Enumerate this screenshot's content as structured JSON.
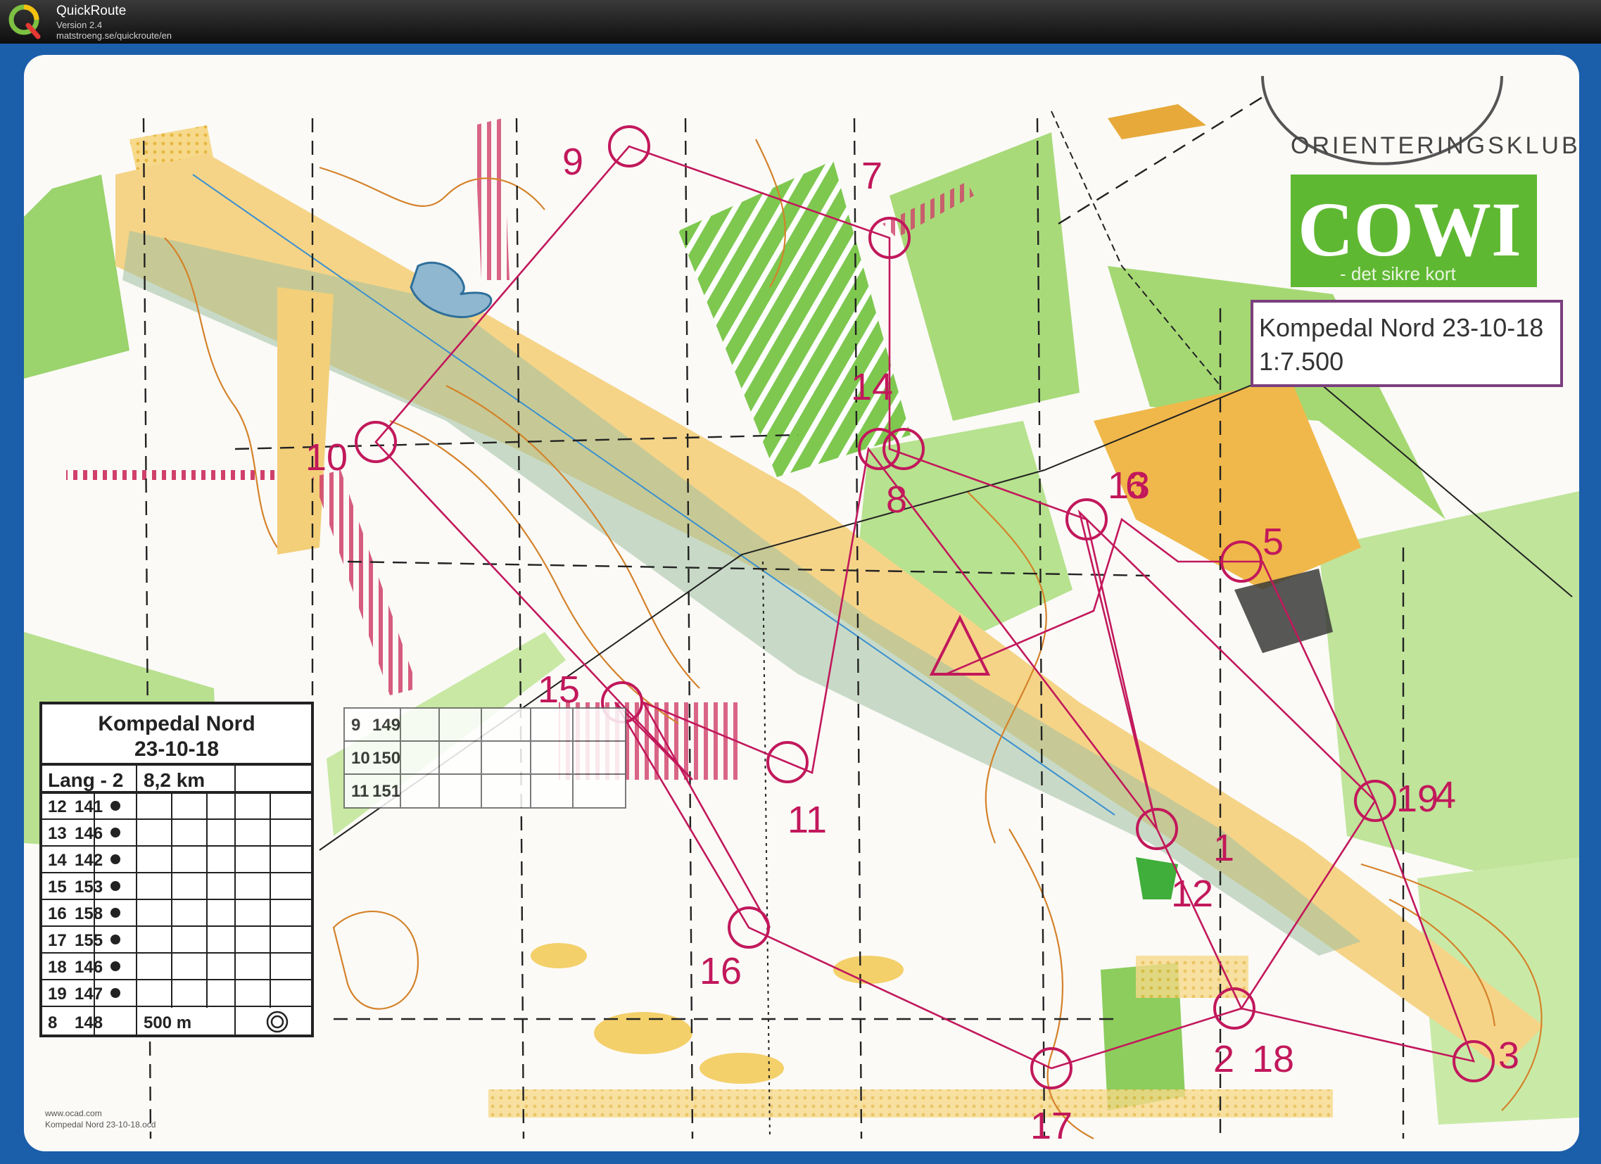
{
  "app": {
    "title": "QuickRoute",
    "version": "Version 2.4",
    "url": "matstroeng.se/quickroute/en"
  },
  "map": {
    "sponsor": "COWI",
    "sponsor_tagline": "- det sikre kort",
    "club_seal": "ORIENTERINGSKLUB",
    "title": "Kompedal Nord 23-10-18",
    "scale": "1:7.500",
    "footnote_1": "www.ocad.com",
    "footnote_2": "Kompedal Nord 23-10-18.ocd"
  },
  "legend": {
    "title": "Kompedal Nord",
    "date": "23-10-18",
    "course": "Lang - 2",
    "distance": "8,2 km",
    "rows": [
      {
        "num": "12",
        "code": "141"
      },
      {
        "num": "13",
        "code": "146"
      },
      {
        "num": "14",
        "code": "142"
      },
      {
        "num": "15",
        "code": "153"
      },
      {
        "num": "16",
        "code": "158"
      },
      {
        "num": "17",
        "code": "155"
      },
      {
        "num": "18",
        "code": "146"
      },
      {
        "num": "19",
        "code": "147"
      }
    ],
    "last_num": "8",
    "last_code": "148",
    "finish_distance": "500 m"
  },
  "legend2": {
    "rows": [
      {
        "num": "9",
        "code": "149"
      },
      {
        "num": "10",
        "code": "150"
      },
      {
        "num": "11",
        "code": "151"
      }
    ]
  },
  "controls": [
    "9",
    "7",
    "10",
    "14",
    "8",
    "13",
    "6",
    "5",
    "15",
    "11",
    "19",
    "4",
    "12",
    "1",
    "16",
    "2",
    "18",
    "3",
    "17"
  ],
  "colors": {
    "course": "#c2185b",
    "open_land": "#f3c860",
    "forest_green": "#8bcf5a",
    "water": "#8fb7cf",
    "frame": "#1b5eaa"
  }
}
